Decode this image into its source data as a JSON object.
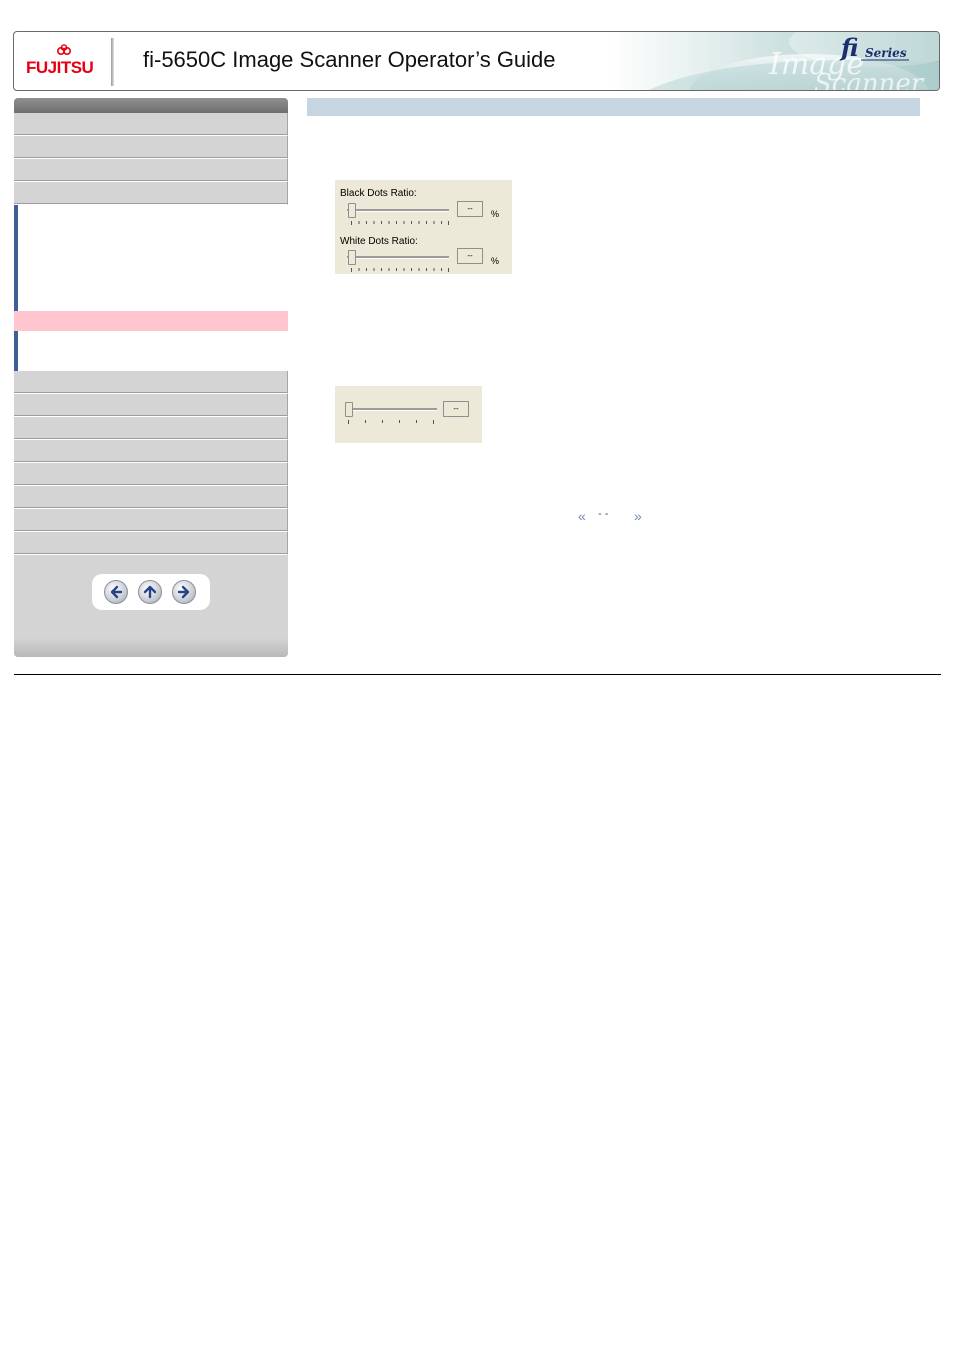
{
  "header": {
    "brand": "FUJITSU",
    "title": "fi-5650C Image Scanner Operator’s Guide",
    "series_badge": "fi Series",
    "art_text": "Image Scanner"
  },
  "sidebar": {
    "items_top_count": 4,
    "items_bottom_count": 8,
    "active_color": "#ffc6cf",
    "accent_color": "#3f5f98"
  },
  "nav": {
    "back_icon": "arrow-left-icon",
    "up_icon": "arrow-up-icon",
    "forward_icon": "arrow-right-icon"
  },
  "content": {
    "title_bar_color": "#c5d6e2",
    "screenshot1": {
      "label1": "Black Dots Ratio:",
      "value1": "--",
      "unit1": "%",
      "label2": "White Dots Ratio:",
      "value2": "--",
      "unit2": "%"
    },
    "screenshot2": {
      "value": "--"
    },
    "pager": {
      "prev_icon": "double-chevron-left-icon",
      "text": "- -",
      "next_icon": "double-chevron-right-icon"
    }
  }
}
